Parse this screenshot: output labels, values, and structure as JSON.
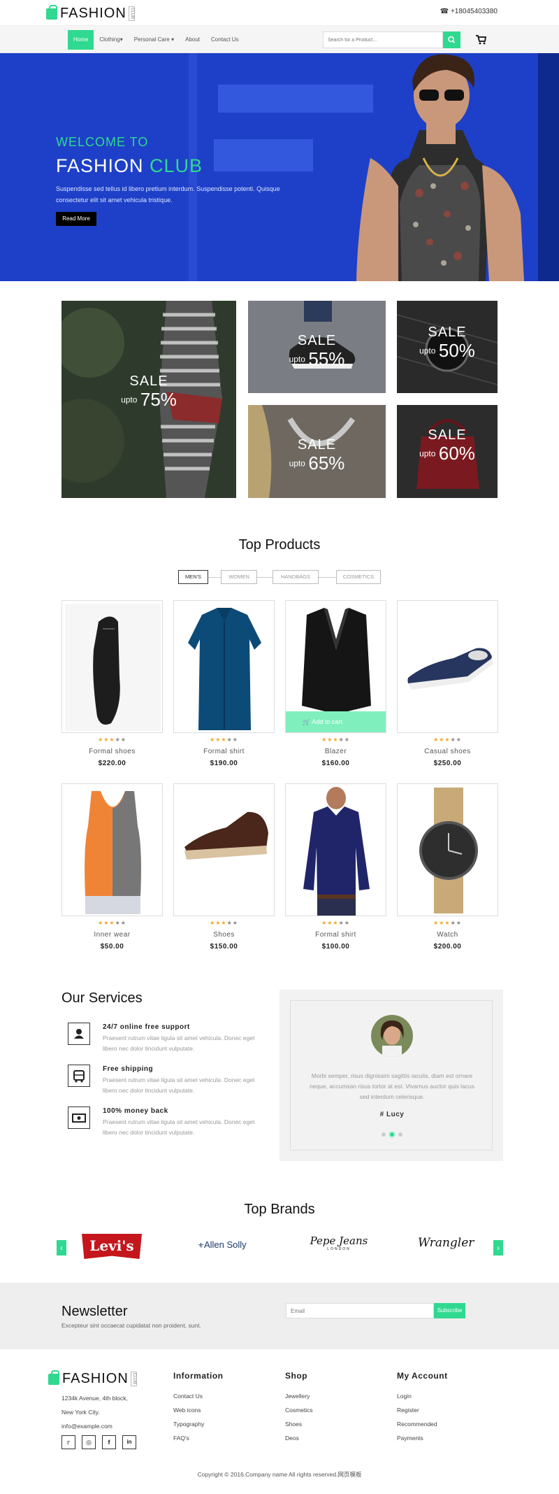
{
  "header": {
    "logo_text": "FASHION",
    "logo_sub": "CLUB",
    "phone": "+18045403380"
  },
  "nav": {
    "items": [
      {
        "label": "Home"
      },
      {
        "label": "Clothing"
      },
      {
        "label": "Personal Care"
      },
      {
        "label": "About"
      },
      {
        "label": "Contact Us"
      }
    ],
    "search_placeholder": "Search for a Product..."
  },
  "hero": {
    "welcome": "WELCOME TO",
    "title_main": "FASHION",
    "title_accent": "CLUB",
    "text": "Suspendisse sed tellus id libero pretium interdum. Suspendisse potenti. Quisque consectetur elit sit amet vehicula tristique.",
    "button": "Read More"
  },
  "sales": [
    {
      "sale": "SALE",
      "upto": "upto",
      "percent": "75%"
    },
    {
      "sale": "SALE",
      "upto": "upto",
      "percent": "55%"
    },
    {
      "sale": "SALE",
      "upto": "upto",
      "percent": "50%"
    },
    {
      "sale": "SALE",
      "upto": "upto",
      "percent": "65%"
    },
    {
      "sale": "SALE",
      "upto": "upto",
      "percent": "60%"
    }
  ],
  "products": {
    "title": "Top Products",
    "tabs": [
      "MEN'S",
      "WOMEN",
      "HANDBAGS",
      "COSMETICS"
    ],
    "add_to_cart": "Add to cart",
    "items": [
      {
        "name": "Formal shoes",
        "price": "$220.00",
        "rating": 3
      },
      {
        "name": "Formal shirt",
        "price": "$190.00",
        "rating": 3
      },
      {
        "name": "Blazer",
        "price": "$160.00",
        "rating": 3
      },
      {
        "name": "Casual shoes",
        "price": "$250.00",
        "rating": 3
      },
      {
        "name": "Inner wear",
        "price": "$50.00",
        "rating": 3
      },
      {
        "name": "Shoes",
        "price": "$150.00",
        "rating": 3
      },
      {
        "name": "Formal shirt",
        "price": "$100.00",
        "rating": 3
      },
      {
        "name": "Watch",
        "price": "$200.00",
        "rating": 3
      }
    ]
  },
  "services": {
    "title": "Our Services",
    "items": [
      {
        "title": "24/7 online free support",
        "desc": "Praesent rutrum vitae ligula sit amet vehicula. Donec eget libero nec dolor tincidunt vulputate.",
        "icon": "user-icon"
      },
      {
        "title": "Free shipping",
        "desc": "Praesent rutrum vitae ligula sit amet vehicula. Donec eget libero nec dolor tincidunt vulputate.",
        "icon": "bus-icon"
      },
      {
        "title": "100% money back",
        "desc": "Praesent rutrum vitae ligula sit amet vehicula. Donec eget libero nec dolor tincidunt vulputate.",
        "icon": "money-icon"
      }
    ]
  },
  "testimonial": {
    "text": "Morbi semper, risus dignissim sagittis iaculis, diam est ornare neque, accumsan risus tortor at est. Vivamus auctor quis lacus sed interdum celerisque.",
    "name": "# Lucy"
  },
  "brands": {
    "title": "Top Brands",
    "items": [
      "Levi's",
      "Allen Solly",
      "Pepe Jeans",
      "Wrangler"
    ],
    "pepe_sub": "LONDON"
  },
  "newsletter": {
    "title": "Newsletter",
    "text": "Excepteur sint occaecat cupidatat non proident, sunt.",
    "placeholder": "Email",
    "button": "Subscribe"
  },
  "footer": {
    "address": [
      "1234k Avenue, 4th block,",
      "New York City.",
      "info@example.com"
    ],
    "columns": [
      {
        "title": "Information",
        "links": [
          "Contact Us",
          "Web icons",
          "Typography",
          "FAQ's"
        ]
      },
      {
        "title": "Shop",
        "links": [
          "Jewellery",
          "Cosmetics",
          "Shoes",
          "Deos"
        ]
      },
      {
        "title": "My Account",
        "links": [
          "Login",
          "Register",
          "Recommended",
          "Payments"
        ]
      }
    ],
    "copyright": "Copyright © 2016.Company name All rights reserved.网页模板"
  },
  "colors": {
    "accent": "#2fd98f",
    "hero_blue": "#1e40c8"
  }
}
